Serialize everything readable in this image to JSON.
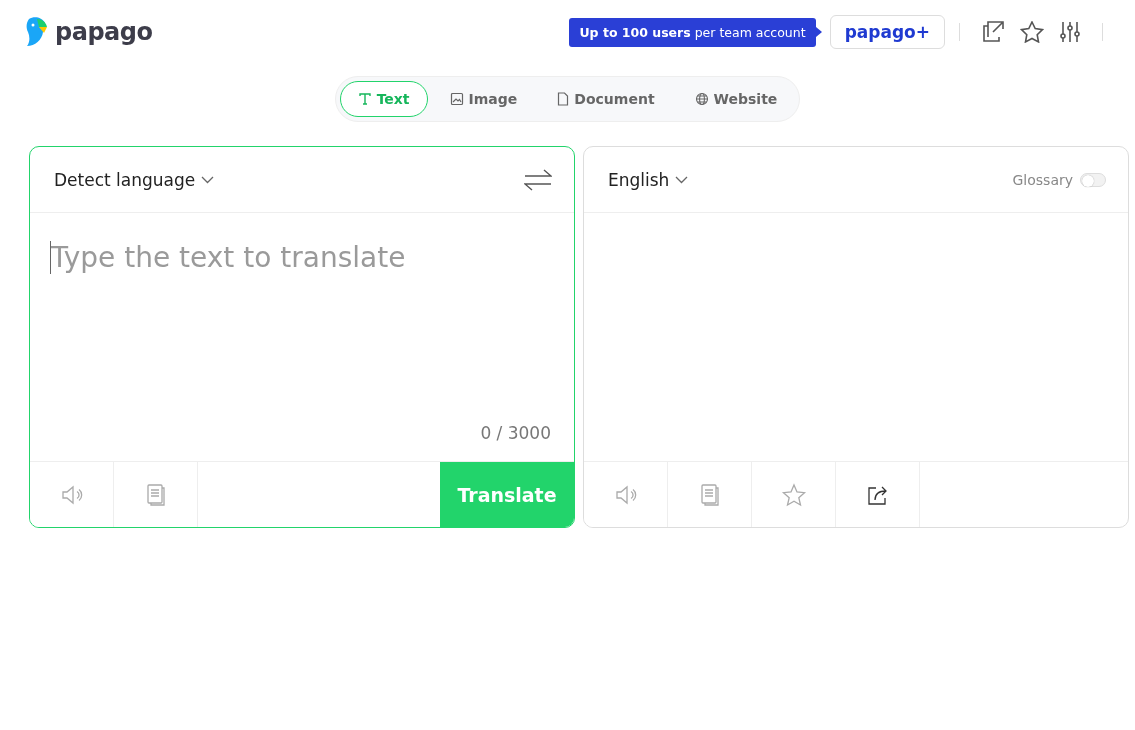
{
  "header": {
    "logo": "papago",
    "promo": "**Up to 100 users** per team account",
    "plus_button": "papago+"
  },
  "tabs": [
    {
      "label": "Text",
      "kind": "text",
      "selected": true
    },
    {
      "label": "Image",
      "kind": "image",
      "selected": false
    },
    {
      "label": "Document",
      "kind": "document",
      "selected": false
    },
    {
      "label": "Website",
      "kind": "website",
      "selected": false
    }
  ],
  "source": {
    "language": "Detect language",
    "placeholder": "Type the text to translate",
    "counter": "0 / 3000",
    "translate_button": "Translate",
    "actions": [
      {
        "kind": "speaker",
        "disabled": true
      },
      {
        "kind": "copy",
        "disabled": true
      }
    ]
  },
  "target": {
    "language": "English",
    "glossary": {
      "label": "Glossary",
      "on": false
    },
    "actions": [
      {
        "kind": "speaker",
        "disabled": true
      },
      {
        "kind": "copy",
        "disabled": true
      },
      {
        "kind": "star",
        "disabled": true
      },
      {
        "kind": "share",
        "disabled": false
      }
    ]
  }
}
